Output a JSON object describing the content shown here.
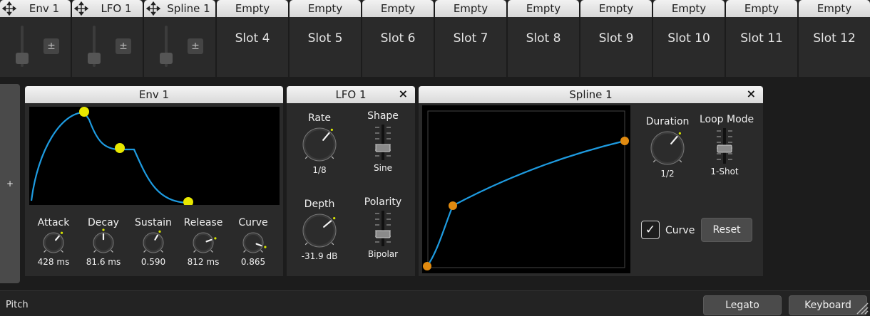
{
  "slots": [
    {
      "title": "Env 1",
      "named": true
    },
    {
      "title": "LFO 1",
      "named": true
    },
    {
      "title": "Spline 1",
      "named": true
    },
    {
      "title": "Empty",
      "label": "Slot 4"
    },
    {
      "title": "Empty",
      "label": "Slot 5"
    },
    {
      "title": "Empty",
      "label": "Slot 6"
    },
    {
      "title": "Empty",
      "label": "Slot 7"
    },
    {
      "title": "Empty",
      "label": "Slot 8"
    },
    {
      "title": "Empty",
      "label": "Slot 9"
    },
    {
      "title": "Empty",
      "label": "Slot 10"
    },
    {
      "title": "Empty",
      "label": "Slot 11"
    },
    {
      "title": "Empty",
      "label": "Slot 12"
    }
  ],
  "slot_control": {
    "plusminus": "±"
  },
  "side_add": "+",
  "env": {
    "title": "Env 1",
    "knobs": [
      {
        "label": "Attack",
        "value": "428 ms"
      },
      {
        "label": "Decay",
        "value": "81.6 ms"
      },
      {
        "label": "Sustain",
        "value": "0.590"
      },
      {
        "label": "Release",
        "value": "812 ms"
      },
      {
        "label": "Curve",
        "value": "0.865"
      }
    ]
  },
  "lfo": {
    "title": "LFO 1",
    "close": "×",
    "rate": {
      "label": "Rate",
      "value": "1/8"
    },
    "depth": {
      "label": "Depth",
      "value": "-31.9 dB"
    },
    "shape": {
      "label": "Shape",
      "value": "Sine"
    },
    "polarity": {
      "label": "Polarity",
      "value": "Bipolar"
    }
  },
  "spline": {
    "title": "Spline 1",
    "close": "×",
    "duration": {
      "label": "Duration",
      "value": "1/2"
    },
    "loop_mode": {
      "label": "Loop Mode",
      "value": "1-Shot"
    },
    "curve_label": "Curve",
    "curve_checked": "✓",
    "reset_label": "Reset"
  },
  "bottom": {
    "pitch_label": "Pitch",
    "legato_label": "Legato",
    "keyboard_label": "Keyboard"
  },
  "colors": {
    "curve": "#1e9be0",
    "env_node": "#e8e800",
    "spline_node": "#e08a10",
    "knob_indicator": "#d8e600"
  }
}
